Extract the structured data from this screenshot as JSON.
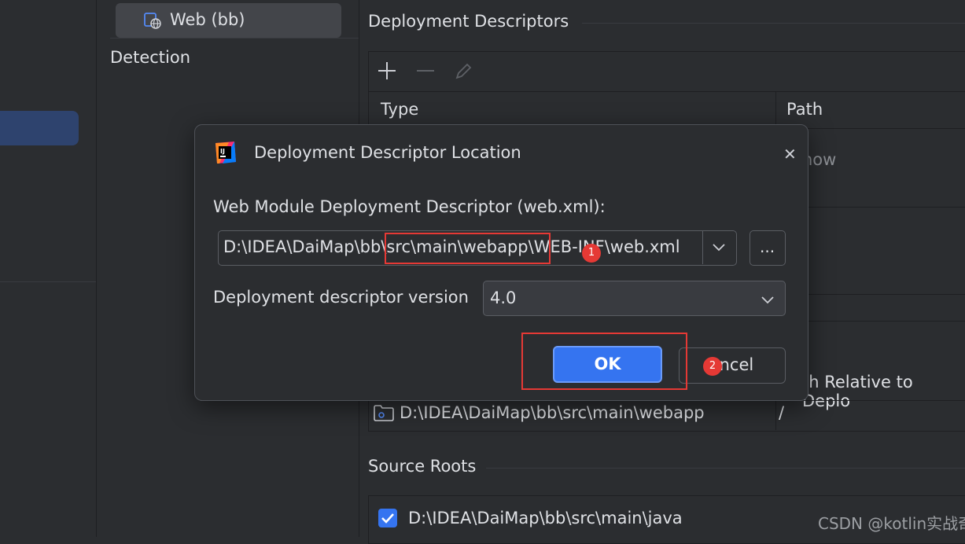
{
  "tree": {
    "web_node": "Web (bb)",
    "detection": "Detection"
  },
  "right": {
    "deployment_descriptors_title": "Deployment Descriptors",
    "columns": {
      "type": "Type",
      "path": "Path"
    },
    "path_partial": "how",
    "directory_relative_header": "th Relative to Deplo",
    "web_resource_dir": "D:\\IDEA\\DaiMap\\bb\\src\\main\\webapp",
    "web_resource_relative": "/",
    "source_roots_title": "Source Roots",
    "source_root": "D:\\IDEA\\DaiMap\\bb\\src\\main\\java",
    "source_root_checked": true
  },
  "dialog": {
    "title": "Deployment Descriptor Location",
    "field_label": "Web Module Deployment Descriptor (web.xml):",
    "path_value": "D:\\IDEA\\DaiMap\\bb\\src\\main\\webapp\\WEB-INF\\web.xml",
    "browse_label": "...",
    "version_label": "Deployment descriptor version",
    "version_value": "4.0",
    "ok_label": "OK",
    "cancel_label": "ancel",
    "close_glyph": "✕"
  },
  "annotations": {
    "badge_1": "1",
    "badge_2": "2"
  },
  "watermark": "CSDN @kotlin实战奇谈",
  "colors": {
    "background": "#2b2d30",
    "accent": "#3574f0",
    "annotation_red": "#e53935"
  }
}
